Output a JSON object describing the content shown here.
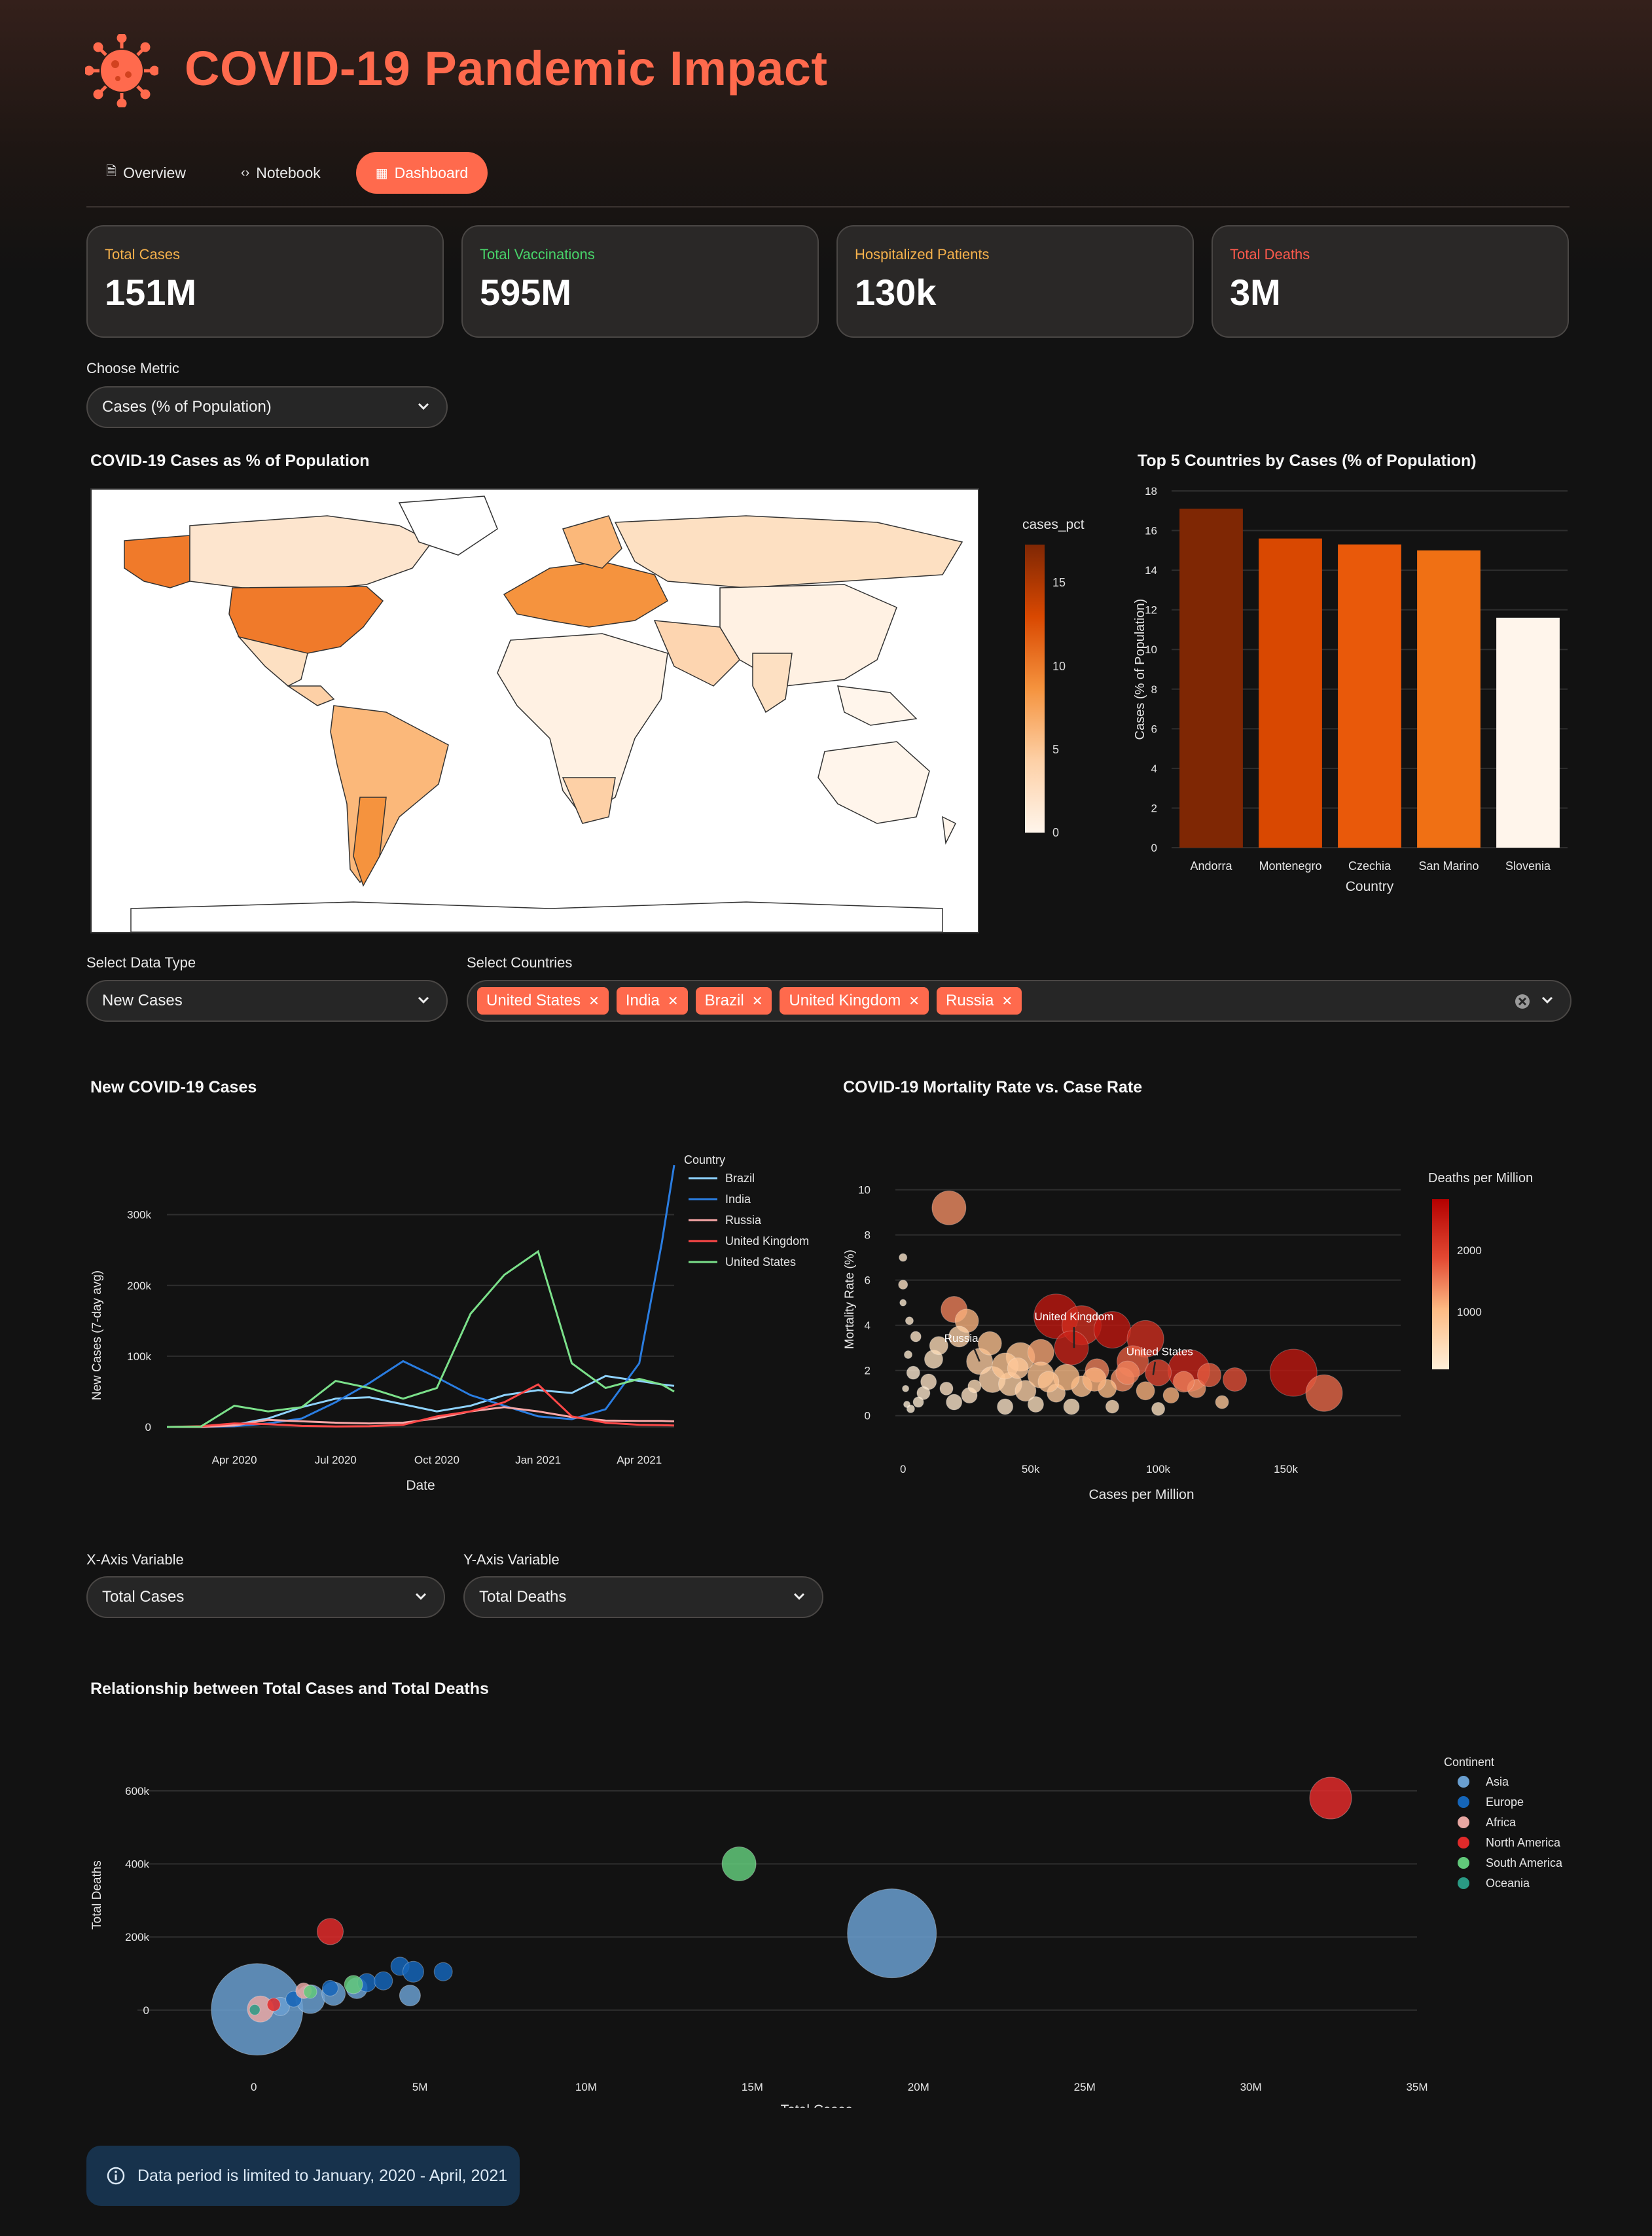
{
  "app": {
    "title": "COVID-19 Pandemic Impact",
    "accent": "#ff6a4d"
  },
  "tabs": [
    {
      "label": "Overview",
      "icon": "document-icon"
    },
    {
      "label": "Notebook",
      "icon": "code-icon"
    },
    {
      "label": "Dashboard",
      "icon": "grid-icon",
      "active": true
    }
  ],
  "kpis": [
    {
      "label": "Total Cases",
      "value": "151M",
      "color": "#f5b14c"
    },
    {
      "label": "Total Vaccinations",
      "value": "595M",
      "color": "#48d46a"
    },
    {
      "label": "Hospitalized Patients",
      "value": "130k",
      "color": "#f5b14c"
    },
    {
      "label": "Total Deaths",
      "value": "3M",
      "color": "#ff5a4d"
    }
  ],
  "metric": {
    "label": "Choose Metric",
    "value": "Cases (% of Population)"
  },
  "map": {
    "title": "COVID-19 Cases as % of Population",
    "colorbar_title": "cases_pct",
    "colorbar_ticks": [
      "15",
      "10",
      "5",
      "0"
    ]
  },
  "top5": {
    "title": "Top 5 Countries by Cases (% of Population)",
    "xlabel": "Country",
    "ylabel": "Cases (% of Population)",
    "yticks": [
      "0",
      "2",
      "4",
      "6",
      "8",
      "10",
      "12",
      "14",
      "16",
      "18"
    ]
  },
  "datatype": {
    "label": "Select Data Type",
    "value": "New Cases"
  },
  "countries": {
    "label": "Select Countries",
    "selected": [
      "United States",
      "India",
      "Brazil",
      "United Kingdom",
      "Russia"
    ]
  },
  "newcases": {
    "title": "New COVID-19 Cases",
    "xlabel": "Date",
    "ylabel": "New Cases (7-day avg)",
    "xticks": [
      "Apr 2020",
      "Jul 2020",
      "Oct 2020",
      "Jan 2021",
      "Apr 2021"
    ],
    "yticks": [
      "0",
      "100k",
      "200k",
      "300k"
    ],
    "legend_title": "Country"
  },
  "mortality": {
    "title": "COVID-19 Mortality Rate vs. Case Rate",
    "xlabel": "Cases per Million",
    "ylabel": "Mortality Rate (%)",
    "xticks": [
      "0",
      "50k",
      "100k",
      "150k"
    ],
    "yticks": [
      "0",
      "2",
      "4",
      "6",
      "8",
      "10"
    ],
    "colorbar_title": "Deaths per Million",
    "colorbar_ticks": [
      "2000",
      "1000"
    ],
    "annotations": [
      "United Kingdom",
      "Russia",
      "United States"
    ]
  },
  "xaxis_select": {
    "label": "X-Axis Variable",
    "value": "Total Cases"
  },
  "yaxis_select": {
    "label": "Y-Axis Variable",
    "value": "Total Deaths"
  },
  "relationship": {
    "title": "Relationship between Total Cases and Total Deaths",
    "xlabel": "Total Cases",
    "ylabel": "Total Deaths",
    "xticks": [
      "0",
      "5M",
      "10M",
      "15M",
      "20M",
      "25M",
      "30M",
      "35M"
    ],
    "yticks": [
      "0",
      "200k",
      "400k",
      "600k"
    ],
    "legend_title": "Continent"
  },
  "info": {
    "text": "Data period is limited to January, 2020 - April, 2021"
  },
  "chart_data": [
    {
      "type": "bar",
      "title": "Top 5 Countries by Cases (% of Population)",
      "categories": [
        "Andorra",
        "Montenegro",
        "Czechia",
        "San Marino",
        "Slovenia"
      ],
      "values": [
        17.1,
        15.6,
        15.3,
        15.0,
        11.6
      ],
      "colors": [
        "#7f2704",
        "#d94801",
        "#e9590a",
        "#f07014",
        "#fff5eb"
      ],
      "xlabel": "Country",
      "ylabel": "Cases (% of Population)",
      "ylim": [
        0,
        18
      ]
    },
    {
      "type": "line",
      "title": "New COVID-19 Cases",
      "xlabel": "Date",
      "ylabel": "New Cases (7-day avg)",
      "ylim": [
        0,
        370000
      ],
      "x": [
        "2020-02",
        "2020-03",
        "2020-04",
        "2020-05",
        "2020-06",
        "2020-07",
        "2020-08",
        "2020-09",
        "2020-10",
        "2020-11",
        "2020-12",
        "2021-01",
        "2021-02",
        "2021-03",
        "2021-04",
        "2021-04-20",
        "2021-05-01"
      ],
      "series": [
        {
          "name": "Brazil",
          "color": "#8fd3ff",
          "values": [
            0,
            100,
            3000,
            12000,
            28000,
            40000,
            42000,
            32000,
            22000,
            30000,
            45000,
            52000,
            48000,
            72000,
            65000,
            60000,
            58000
          ]
        },
        {
          "name": "India",
          "color": "#2a7de1",
          "values": [
            0,
            100,
            1000,
            5000,
            12000,
            35000,
            62000,
            93000,
            70000,
            45000,
            30000,
            15000,
            11000,
            25000,
            90000,
            260000,
            370000
          ]
        },
        {
          "name": "Russia",
          "color": "#f7a7a7",
          "values": [
            0,
            0,
            2000,
            10000,
            8000,
            6000,
            5000,
            6000,
            12000,
            22000,
            28000,
            22000,
            14000,
            9000,
            8500,
            8500,
            8000
          ]
        },
        {
          "name": "United Kingdom",
          "color": "#ff4848",
          "values": [
            0,
            1000,
            5000,
            4000,
            1500,
            700,
            1000,
            3000,
            15000,
            22000,
            35000,
            60000,
            15000,
            6000,
            3000,
            2500,
            2000
          ]
        },
        {
          "name": "United States",
          "color": "#7be08a",
          "values": [
            0,
            500,
            30000,
            22000,
            28000,
            65000,
            55000,
            40000,
            55000,
            160000,
            215000,
            248000,
            90000,
            55000,
            68000,
            60000,
            50000
          ]
        }
      ]
    },
    {
      "type": "scatter",
      "title": "COVID-19 Mortality Rate vs. Case Rate",
      "xlabel": "Cases per Million",
      "ylabel": "Mortality Rate (%)",
      "xlim": [
        -3000,
        195000
      ],
      "ylim": [
        -0.5,
        10.8
      ],
      "points": [
        [
          18000,
          9.2,
          1400,
          26
        ],
        [
          0,
          7,
          150,
          6
        ],
        [
          0,
          5.8,
          250,
          7
        ],
        [
          0,
          5,
          100,
          5
        ],
        [
          20000,
          4.7,
          1500,
          20
        ],
        [
          25000,
          4.2,
          1100,
          18
        ],
        [
          60000,
          4.4,
          2400,
          34
        ],
        [
          70000,
          4.0,
          2200,
          30
        ],
        [
          82000,
          3.8,
          2400,
          28
        ],
        [
          95000,
          3.4,
          2200,
          28
        ],
        [
          66000,
          3.0,
          2300,
          26
        ],
        [
          46000,
          2.6,
          900,
          22
        ],
        [
          54000,
          2.8,
          1200,
          20
        ],
        [
          112000,
          2.0,
          2300,
          32
        ],
        [
          153000,
          1.9,
          2400,
          36
        ],
        [
          165000,
          1.0,
          1700,
          28
        ],
        [
          90000,
          2.4,
          1800,
          24
        ],
        [
          86000,
          1.6,
          1400,
          18
        ],
        [
          100000,
          1.9,
          2000,
          20
        ],
        [
          76000,
          2.0,
          1500,
          18
        ],
        [
          30000,
          2.4,
          700,
          20
        ],
        [
          35000,
          1.6,
          600,
          20
        ],
        [
          42000,
          1.4,
          650,
          18
        ],
        [
          48000,
          1.1,
          600,
          16
        ],
        [
          60000,
          1.0,
          700,
          14
        ],
        [
          70000,
          1.3,
          900,
          16
        ],
        [
          80000,
          1.2,
          1000,
          14
        ],
        [
          95000,
          1.1,
          1100,
          14
        ],
        [
          105000,
          0.9,
          1100,
          12
        ],
        [
          115000,
          1.2,
          1300,
          14
        ],
        [
          12000,
          2.5,
          300,
          14
        ],
        [
          14000,
          3.1,
          400,
          14
        ],
        [
          10000,
          1.5,
          250,
          12
        ],
        [
          8000,
          1.0,
          150,
          10
        ],
        [
          6000,
          0.6,
          80,
          8
        ],
        [
          4000,
          1.9,
          90,
          10
        ],
        [
          3000,
          0.3,
          40,
          6
        ],
        [
          20000,
          0.6,
          150,
          12
        ],
        [
          26000,
          0.9,
          250,
          12
        ],
        [
          40000,
          0.4,
          200,
          12
        ],
        [
          52000,
          0.5,
          300,
          12
        ],
        [
          66000,
          0.4,
          300,
          12
        ],
        [
          82000,
          0.4,
          400,
          10
        ],
        [
          100000,
          0.3,
          300,
          10
        ],
        [
          125000,
          0.6,
          800,
          10
        ],
        [
          22000,
          3.5,
          600,
          16
        ],
        [
          34000,
          3.2,
          900,
          18
        ],
        [
          40000,
          2.2,
          850,
          20
        ],
        [
          54000,
          1.8,
          900,
          20
        ],
        [
          64000,
          1.7,
          1000,
          20
        ],
        [
          5000,
          3.5,
          200,
          8
        ],
        [
          2000,
          2.7,
          120,
          6
        ],
        [
          1000,
          1.2,
          60,
          5
        ],
        [
          1500,
          0.5,
          40,
          5
        ],
        [
          2500,
          4.2,
          130,
          6
        ],
        [
          17000,
          1.2,
          250,
          10
        ],
        [
          28000,
          1.3,
          400,
          10
        ],
        [
          45000,
          2.1,
          800,
          16
        ],
        [
          57000,
          1.5,
          900,
          16
        ],
        [
          75000,
          1.6,
          1100,
          18
        ],
        [
          88000,
          1.9,
          1500,
          18
        ],
        [
          110000,
          1.5,
          1500,
          16
        ],
        [
          120000,
          1.8,
          1800,
          18
        ],
        [
          130000,
          1.6,
          1900,
          18
        ]
      ],
      "annotated": [
        {
          "label": "United Kingdom",
          "x": 67000,
          "y": 3.0
        },
        {
          "label": "Russia",
          "x": 30000,
          "y": 2.4
        },
        {
          "label": "United States",
          "x": 98000,
          "y": 1.8
        }
      ]
    },
    {
      "type": "scatter",
      "title": "Relationship between Total Cases and Total Deaths",
      "xlabel": "Total Cases",
      "ylabel": "Total Deaths",
      "xlim": [
        -3500000,
        35000000
      ],
      "ylim": [
        -70000,
        700000
      ],
      "continents": [
        {
          "name": "Asia",
          "color": "#6a9fd0"
        },
        {
          "name": "Europe",
          "color": "#1565b8"
        },
        {
          "name": "Africa",
          "color": "#e8a7a2"
        },
        {
          "name": "North America",
          "color": "#e02a2a"
        },
        {
          "name": "South America",
          "color": "#61c97a"
        },
        {
          "name": "Oceania",
          "color": "#2a9a84"
        }
      ],
      "points": [
        [
          100000,
          2000,
          "Asia",
          70
        ],
        [
          19200000,
          210000,
          "Asia",
          68
        ],
        [
          1700000,
          30000,
          "Asia",
          22
        ],
        [
          2400000,
          45000,
          "Asia",
          18
        ],
        [
          3100000,
          60000,
          "Asia",
          16
        ],
        [
          4700000,
          40000,
          "Asia",
          16
        ],
        [
          800000,
          10000,
          "Asia",
          14
        ],
        [
          3400000,
          75000,
          "Europe",
          14
        ],
        [
          3900000,
          80000,
          "Europe",
          14
        ],
        [
          4400000,
          120000,
          "Europe",
          14
        ],
        [
          4800000,
          105000,
          "Europe",
          16
        ],
        [
          5700000,
          105000,
          "Europe",
          14
        ],
        [
          2300000,
          60000,
          "Europe",
          12
        ],
        [
          1200000,
          30000,
          "Europe",
          12
        ],
        [
          200000,
          3000,
          "Africa",
          20
        ],
        [
          1500000,
          53000,
          "Africa",
          12
        ],
        [
          2300000,
          215000,
          "North America",
          20
        ],
        [
          32400000,
          580000,
          "North America",
          32
        ],
        [
          600000,
          15000,
          "North America",
          10
        ],
        [
          14600000,
          400000,
          "South America",
          26
        ],
        [
          3000000,
          70000,
          "South America",
          14
        ],
        [
          1700000,
          50000,
          "South America",
          10
        ],
        [
          29000,
          900,
          "Oceania",
          8
        ]
      ]
    }
  ]
}
